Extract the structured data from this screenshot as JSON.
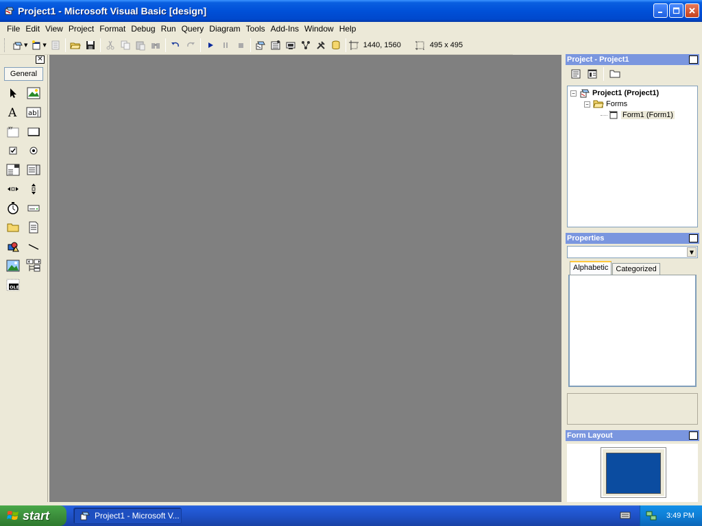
{
  "window": {
    "title": "Project1 - Microsoft Visual Basic [design]"
  },
  "menu": [
    "File",
    "Edit",
    "View",
    "Project",
    "Format",
    "Debug",
    "Run",
    "Query",
    "Diagram",
    "Tools",
    "Add-Ins",
    "Window",
    "Help"
  ],
  "toolbar": {
    "position": "1440, 1560",
    "size": "495 x 495"
  },
  "toolbox": {
    "tab_label": "General",
    "tools": [
      "pointer-icon",
      "picturebox-icon",
      "label-icon",
      "textbox-icon",
      "frame-icon",
      "commandbutton-icon",
      "checkbox-icon",
      "optionbutton-icon",
      "combobox-icon",
      "listbox-icon",
      "hscrollbar-icon",
      "vscrollbar-icon",
      "timer-icon",
      "drivelistbox-icon",
      "dirlistbox-icon",
      "filelistbox-icon",
      "shape-icon",
      "line-icon",
      "image-icon",
      "data-icon",
      "ole-icon"
    ]
  },
  "project_panel": {
    "title": "Project - Project1",
    "tree": {
      "root": "Project1 (Project1)",
      "folder": "Forms",
      "item": "Form1 (Form1)"
    }
  },
  "properties_panel": {
    "title": "Properties",
    "combo_value": "",
    "tabs": [
      "Alphabetic",
      "Categorized"
    ]
  },
  "form_layout_panel": {
    "title": "Form Layout"
  },
  "taskbar": {
    "start_label": "start",
    "task_label": "Project1 - Microsoft V...",
    "clock": "3:49 PM"
  },
  "colors": {
    "titlebar": "#0050D8",
    "mdi_background": "#808080",
    "panel_title": "#7A96DF",
    "taskbar": "#245EDC",
    "start_button": "#3C8F3C",
    "monitor_screen": "#0B4CA0"
  }
}
